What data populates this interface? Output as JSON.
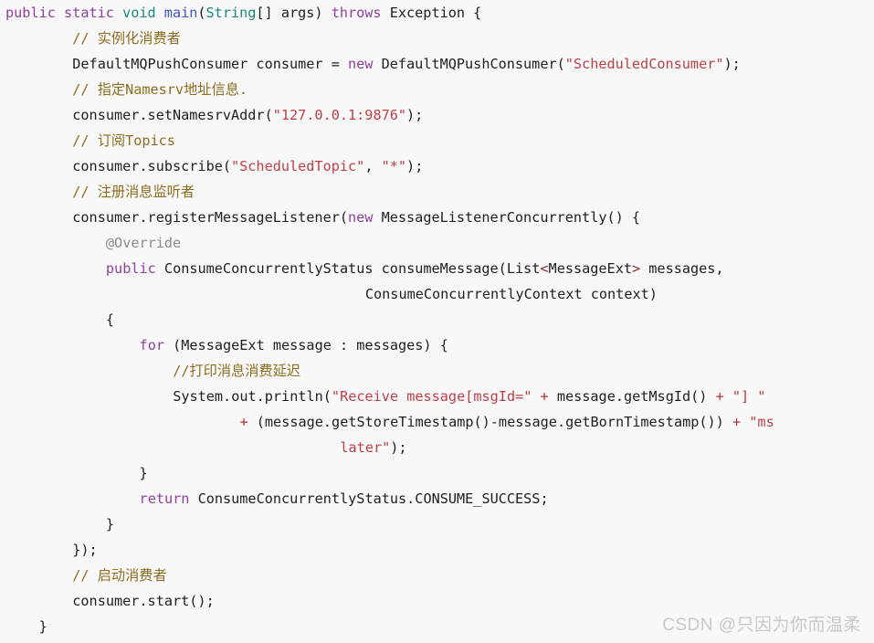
{
  "meta": {
    "language": "java",
    "background_color": "#f8f8f8",
    "default_text_color": "#1a1a1a"
  },
  "palette": {
    "keyword": "#8f3f9e",
    "type": "#1a8a7a",
    "function": "#3b55c4",
    "string": "#bc3f46",
    "comment": "#8c6d1f",
    "annotation": "#8a8a8a",
    "generic_bracket": "#8c2d2d",
    "operator": "#b23030",
    "plain": "#202020",
    "watermark": "#c9c9c9"
  },
  "watermark": {
    "text": "CSDN @只因为你而温柔"
  },
  "code": {
    "lines": [
      {
        "n": 1,
        "indent": 0,
        "text": "public static void main(String[] args) throws Exception {",
        "tokens": [
          {
            "t": "public",
            "c": "kw"
          },
          {
            "t": " ",
            "c": "plain"
          },
          {
            "t": "static",
            "c": "kw"
          },
          {
            "t": " ",
            "c": "plain"
          },
          {
            "t": "void",
            "c": "type"
          },
          {
            "t": " ",
            "c": "plain"
          },
          {
            "t": "main",
            "c": "fn"
          },
          {
            "t": "(",
            "c": "plain"
          },
          {
            "t": "String",
            "c": "type"
          },
          {
            "t": "[] args) ",
            "c": "plain"
          },
          {
            "t": "throws",
            "c": "kw"
          },
          {
            "t": " Exception {",
            "c": "plain"
          }
        ]
      },
      {
        "n": 2,
        "indent": 8,
        "text": "// 实例化消费者",
        "tokens": [
          {
            "t": "// 实例化消费者",
            "c": "cmt"
          }
        ]
      },
      {
        "n": 3,
        "indent": 8,
        "text": "DefaultMQPushConsumer consumer = new DefaultMQPushConsumer(\"ScheduledConsumer\");",
        "tokens": [
          {
            "t": "DefaultMQPushConsumer consumer = ",
            "c": "plain"
          },
          {
            "t": "new",
            "c": "kw"
          },
          {
            "t": " DefaultMQPushConsumer(",
            "c": "plain"
          },
          {
            "t": "\"ScheduledConsumer\"",
            "c": "str"
          },
          {
            "t": ");",
            "c": "plain"
          }
        ]
      },
      {
        "n": 4,
        "indent": 8,
        "text": "// 指定Namesrv地址信息.",
        "tokens": [
          {
            "t": "// 指定Namesrv地址信息.",
            "c": "cmt"
          }
        ]
      },
      {
        "n": 5,
        "indent": 8,
        "text": "consumer.setNamesrvAddr(\"127.0.0.1:9876\");",
        "tokens": [
          {
            "t": "consumer.setNamesrvAddr(",
            "c": "plain"
          },
          {
            "t": "\"127.0.0.1:9876\"",
            "c": "str"
          },
          {
            "t": ");",
            "c": "plain"
          }
        ]
      },
      {
        "n": 6,
        "indent": 8,
        "text": "// 订阅Topics",
        "tokens": [
          {
            "t": "// 订阅Topics",
            "c": "cmt"
          }
        ]
      },
      {
        "n": 7,
        "indent": 8,
        "text": "consumer.subscribe(\"ScheduledTopic\", \"*\");",
        "tokens": [
          {
            "t": "consumer.subscribe(",
            "c": "plain"
          },
          {
            "t": "\"ScheduledTopic\"",
            "c": "str"
          },
          {
            "t": ", ",
            "c": "plain"
          },
          {
            "t": "\"*\"",
            "c": "str"
          },
          {
            "t": ");",
            "c": "plain"
          }
        ]
      },
      {
        "n": 8,
        "indent": 8,
        "text": "// 注册消息监听者",
        "tokens": [
          {
            "t": "// 注册消息监听者",
            "c": "cmt"
          }
        ]
      },
      {
        "n": 9,
        "indent": 8,
        "text": "consumer.registerMessageListener(new MessageListenerConcurrently() {",
        "tokens": [
          {
            "t": "consumer.registerMessageListener(",
            "c": "plain"
          },
          {
            "t": "new",
            "c": "kw"
          },
          {
            "t": " MessageListenerConcurrently() {",
            "c": "plain"
          }
        ]
      },
      {
        "n": 10,
        "indent": 12,
        "text": "@Override",
        "tokens": [
          {
            "t": "@Override",
            "c": "ann"
          }
        ]
      },
      {
        "n": 11,
        "indent": 12,
        "text": "public ConsumeConcurrentlyStatus consumeMessage(List<MessageExt> messages,",
        "tokens": [
          {
            "t": "public",
            "c": "kw"
          },
          {
            "t": " ConsumeConcurrentlyStatus consumeMessage(List",
            "c": "plain"
          },
          {
            "t": "<",
            "c": "gen"
          },
          {
            "t": "MessageExt",
            "c": "plain"
          },
          {
            "t": ">",
            "c": "gen"
          },
          {
            "t": " messages,",
            "c": "plain"
          }
        ]
      },
      {
        "n": 12,
        "indent": 43,
        "text": "ConsumeConcurrentlyContext context)",
        "tokens": [
          {
            "t": "ConsumeConcurrentlyContext context)",
            "c": "plain"
          }
        ]
      },
      {
        "n": 13,
        "indent": 12,
        "text": "{",
        "tokens": [
          {
            "t": "{",
            "c": "plain"
          }
        ]
      },
      {
        "n": 14,
        "indent": 16,
        "text": "for (MessageExt message : messages) {",
        "tokens": [
          {
            "t": "for",
            "c": "kw"
          },
          {
            "t": " (MessageExt message : messages) {",
            "c": "plain"
          }
        ]
      },
      {
        "n": 15,
        "indent": 20,
        "text": "//打印消息消费延迟",
        "tokens": [
          {
            "t": "//打印消息消费延迟",
            "c": "cmt"
          }
        ]
      },
      {
        "n": 16,
        "indent": 20,
        "text": "System.out.println(\"Receive message[msgId=\" + message.getMsgId() + \"] \"",
        "tokens": [
          {
            "t": "System.out.println(",
            "c": "plain"
          },
          {
            "t": "\"Receive message[msgId=\"",
            "c": "str"
          },
          {
            "t": " ",
            "c": "plain"
          },
          {
            "t": "+",
            "c": "op"
          },
          {
            "t": " message.getMsgId() ",
            "c": "plain"
          },
          {
            "t": "+",
            "c": "op"
          },
          {
            "t": " ",
            "c": "plain"
          },
          {
            "t": "\"] \"",
            "c": "str"
          }
        ]
      },
      {
        "n": 17,
        "indent": 28,
        "text": "+ (message.getStoreTimestamp()-message.getBornTimestamp()) + \"ms",
        "tokens": [
          {
            "t": "+",
            "c": "op"
          },
          {
            "t": " (message.getStoreTimestamp()-message.getBornTimestamp()) ",
            "c": "plain"
          },
          {
            "t": "+",
            "c": "op"
          },
          {
            "t": " ",
            "c": "plain"
          },
          {
            "t": "\"ms",
            "c": "str"
          }
        ]
      },
      {
        "n": 18,
        "indent": 40,
        "text": "later\");",
        "tokens": [
          {
            "t": "later\"",
            "c": "str"
          },
          {
            "t": ");",
            "c": "plain"
          }
        ]
      },
      {
        "n": 19,
        "indent": 16,
        "text": "}",
        "tokens": [
          {
            "t": "}",
            "c": "plain"
          }
        ]
      },
      {
        "n": 20,
        "indent": 16,
        "text": "return ConsumeConcurrentlyStatus.CONSUME_SUCCESS;",
        "tokens": [
          {
            "t": "return",
            "c": "kw"
          },
          {
            "t": " ConsumeConcurrentlyStatus.CONSUME_SUCCESS;",
            "c": "plain"
          }
        ]
      },
      {
        "n": 21,
        "indent": 12,
        "text": "}",
        "tokens": [
          {
            "t": "}",
            "c": "plain"
          }
        ]
      },
      {
        "n": 22,
        "indent": 8,
        "text": "});",
        "tokens": [
          {
            "t": "});",
            "c": "plain"
          }
        ]
      },
      {
        "n": 23,
        "indent": 8,
        "text": "// 启动消费者",
        "tokens": [
          {
            "t": "// 启动消费者",
            "c": "cmt"
          }
        ]
      },
      {
        "n": 24,
        "indent": 8,
        "text": "consumer.start();",
        "tokens": [
          {
            "t": "consumer.start();",
            "c": "plain"
          }
        ]
      },
      {
        "n": 25,
        "indent": 4,
        "text": "}",
        "tokens": [
          {
            "t": "}",
            "c": "plain"
          }
        ]
      }
    ]
  }
}
